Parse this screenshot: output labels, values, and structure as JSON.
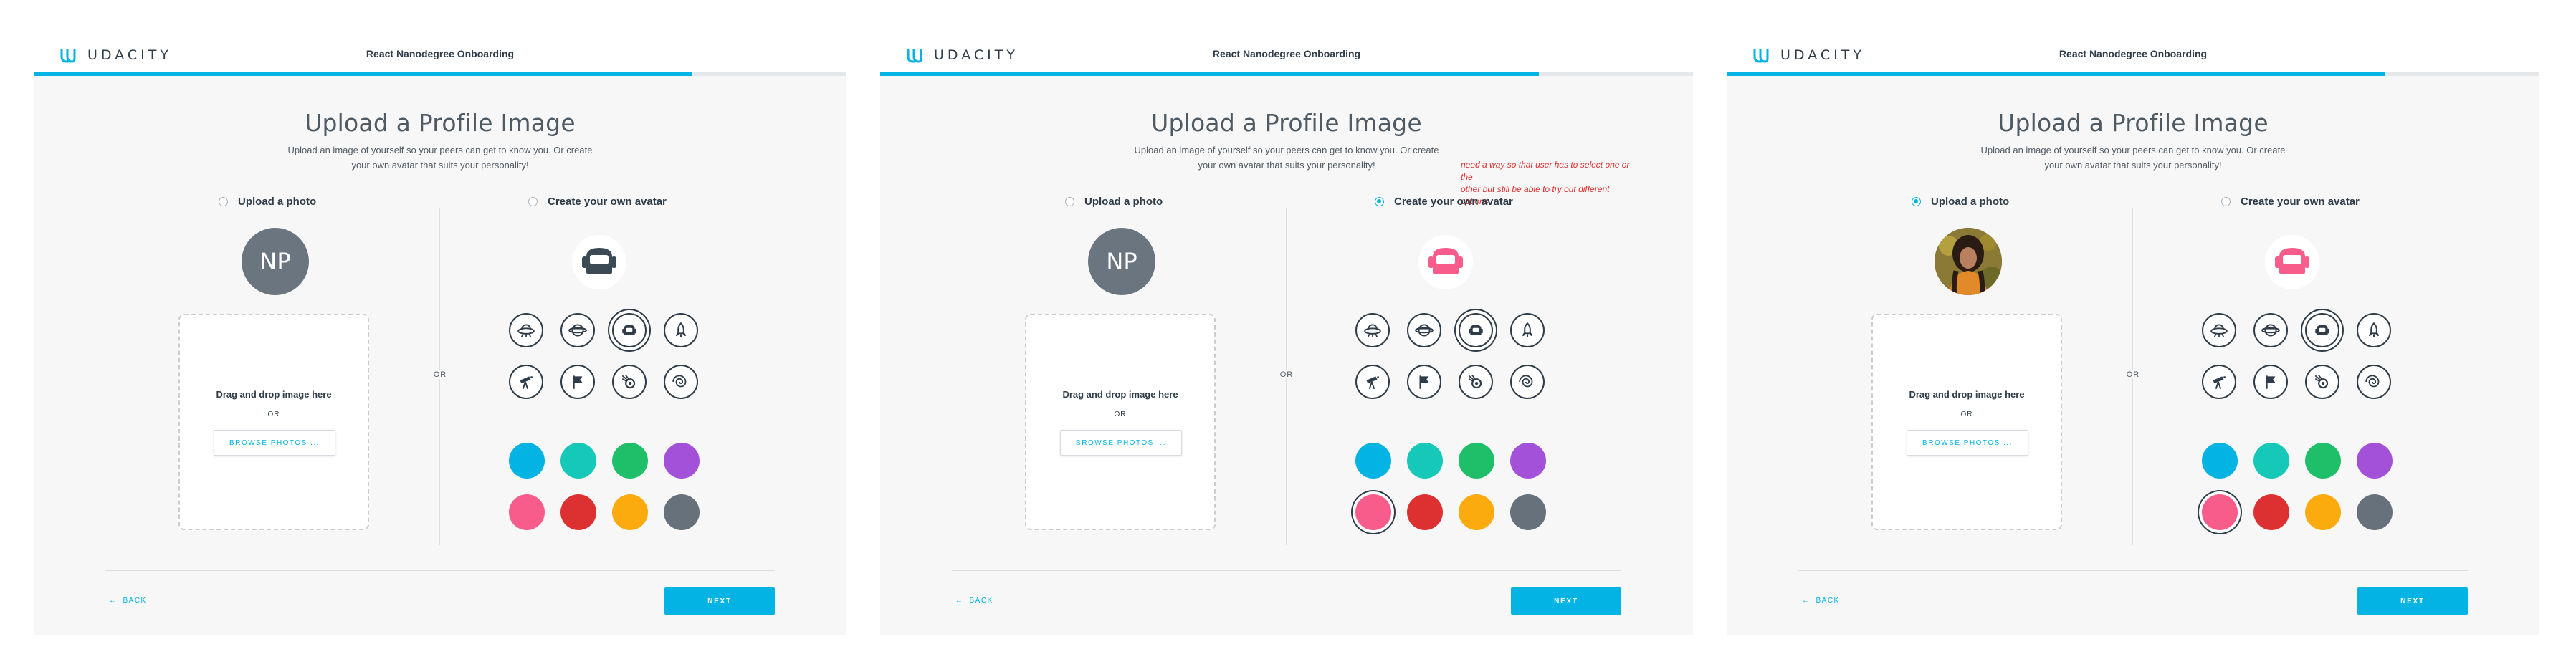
{
  "app": {
    "brand": "UDACITY",
    "header_title": "React Nanodegree Onboarding",
    "brand_color": "#02b3e4",
    "progress": 0.81
  },
  "page": {
    "title": "Upload a Profile Image",
    "subtitle_line1": "Upload an image of yourself so your peers can get to know you. Or create",
    "subtitle_line2": "your own avatar that suits your personality!"
  },
  "options": {
    "upload_label": "Upload a photo",
    "create_label": "Create your own avatar",
    "or_label": "OR"
  },
  "upload": {
    "initials": "NP",
    "drag_text": "Drag and drop image here",
    "or_text": "OR",
    "browse_label": "BROWSE PHOTOS ..."
  },
  "avatar_icons": [
    "ufo-icon",
    "planet-icon",
    "robot-head-icon",
    "rocket-icon",
    "telescope-icon",
    "flag-icon",
    "comet-icon",
    "galaxy-icon"
  ],
  "avatar_colors": [
    "#02b3e4",
    "#15c8b8",
    "#1fbf6a",
    "#a451d9",
    "#f75c8a",
    "#dd3131",
    "#fcab0f",
    "#67717b"
  ],
  "footer": {
    "back_label": "BACK",
    "next_label": "NEXT"
  },
  "annotation": {
    "line1": "need a way so that user has to select one or the",
    "line2": "other but still be able to try out different options"
  },
  "panels": [
    {
      "selected_option": "none",
      "avatar_color": "#3c4a55",
      "selected_color": -1,
      "show_photo": false,
      "show_note": false
    },
    {
      "selected_option": "create",
      "avatar_color": "#f75c8a",
      "selected_color": 4,
      "show_photo": false,
      "show_note": true
    },
    {
      "selected_option": "upload",
      "avatar_color": "#f75c8a",
      "selected_color": 4,
      "show_photo": true,
      "show_note": false
    }
  ]
}
